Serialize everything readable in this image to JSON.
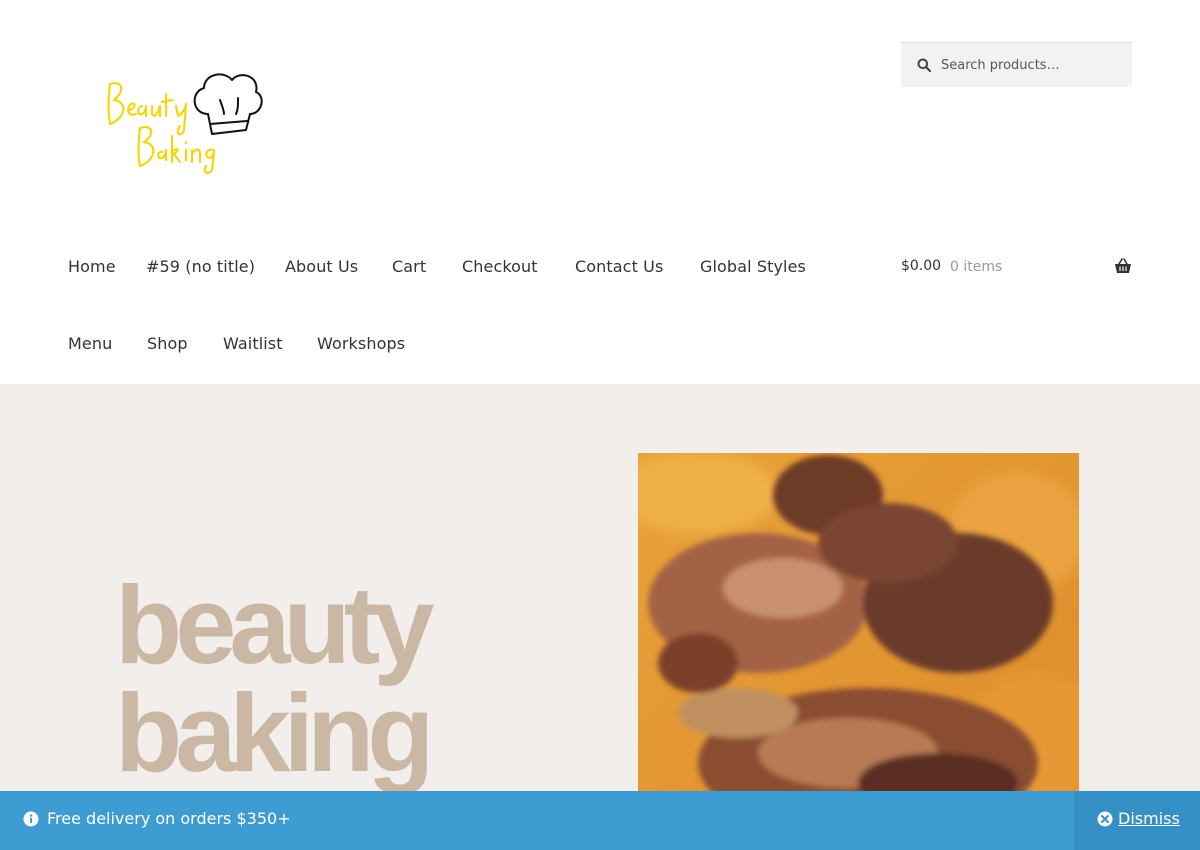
{
  "brand": {
    "logo_name": "Beauty Baking"
  },
  "search": {
    "placeholder": "Search products…"
  },
  "nav": {
    "row1": [
      "Home",
      "#59 (no title)",
      "About Us",
      "Cart",
      "Checkout",
      "Contact Us",
      "Global Styles"
    ],
    "row2": [
      "Menu",
      "Shop",
      "Waitlist",
      "Workshops"
    ]
  },
  "cart": {
    "total": "$0.00",
    "count": "0 items"
  },
  "hero": {
    "line1": "beauty",
    "line2": "baking"
  },
  "notice": {
    "text": "Free delivery on orders $350+",
    "dismiss": "Dismiss"
  },
  "colors": {
    "accent": "#3d9cd2",
    "hero_bg": "#f1eeec",
    "hero_title": "#cbb8a4",
    "logo_yellow": "#f5d60b"
  }
}
